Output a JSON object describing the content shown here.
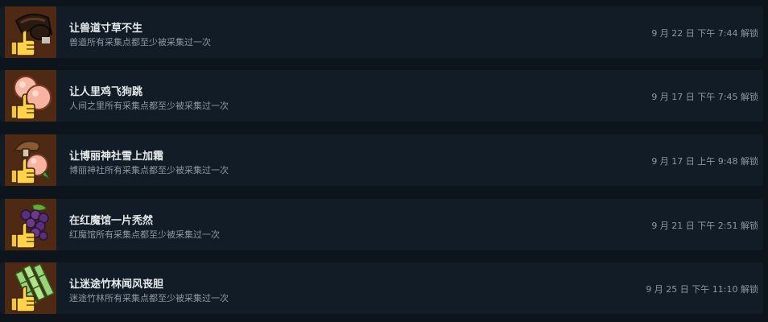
{
  "achievements": [
    {
      "title": "让兽道寸草不生",
      "description": "兽道所有采集点都至少被采集过一次",
      "unlock_time": "9 月 22 日 下午 7:44 解锁",
      "icon": "thumbs-up-leather-belt-icon"
    },
    {
      "title": "让人里鸡飞狗跳",
      "description": "人间之里所有采集点都至少被采集过一次",
      "unlock_time": "9 月 17 日 下午 7:45 解锁",
      "icon": "thumbs-up-peach-icon"
    },
    {
      "title": "让博丽神社雪上加霜",
      "description": "博丽神社所有采集点都至少被采集过一次",
      "unlock_time": "9 月 17 日 上午 9:48 解锁",
      "icon": "thumbs-up-mushroom-peach-icon"
    },
    {
      "title": "在红魔馆一片秃然",
      "description": "红魔馆所有采集点都至少被采集过一次",
      "unlock_time": "9 月 21 日 下午 2:51 解锁",
      "icon": "thumbs-up-grapes-icon"
    },
    {
      "title": "让迷途竹林闻风丧胆",
      "description": "迷途竹林所有采集点都至少被采集过一次",
      "unlock_time": "9 月 25 日 下午 11:10 解锁",
      "icon": "thumbs-up-bamboo-icon"
    }
  ],
  "colors": {
    "page_background": "#0e141b",
    "row_background": "#111c26",
    "icon_background": "#4e2a14",
    "title_text": "#e6e8ea",
    "secondary_text": "#8f98a0"
  }
}
